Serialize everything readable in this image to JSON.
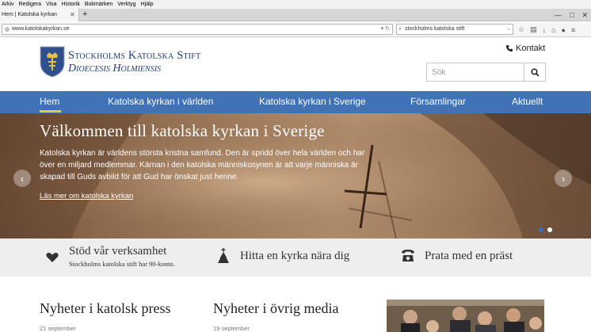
{
  "browser": {
    "menu": [
      "Arkiv",
      "Redigera",
      "Visa",
      "Historik",
      "Bokmärken",
      "Verktyg",
      "Hjälp"
    ],
    "tab_title": "Hem | Katolska kyrkan",
    "url": "www.katolskakyrkan.se",
    "search_value": "stockholms katolska stift",
    "icons": [
      "star-icon",
      "reading-list-icon",
      "download-icon",
      "home-icon",
      "chat-icon",
      "menu-icon"
    ]
  },
  "header": {
    "site_name": "Stockholms Katolska Stift",
    "site_latin": "Dioecesis Holmiensis",
    "contact_label": "Kontakt",
    "search_placeholder": "Sök"
  },
  "nav": {
    "items": [
      {
        "label": "Hem",
        "active": true
      },
      {
        "label": "Katolska kyrkan i världen"
      },
      {
        "label": "Katolska kyrkan i Sverige"
      },
      {
        "label": "Församlingar"
      },
      {
        "label": "Aktuellt"
      }
    ],
    "accent": "#f0c63a",
    "color": "#3f72b7"
  },
  "hero": {
    "title": "Välkommen till katolska kyrkan i Sverige",
    "text": "Katolska kyrkan är världens största kristna samfund. Den är spridd över hela världen och har över en miljard medlemmar. Kärnan i den katolska människosynen är att varje människa är skapad till Guds avbild för att Gud har önskat just henne.",
    "link": "Läs mer om katolska kyrkan",
    "slides_total": 2,
    "active_slide": 1
  },
  "features": [
    {
      "title": "Stöd vår verksamhet",
      "sub": "Stockholms katolska stift har 90-konto.",
      "icon": "heart-icon"
    },
    {
      "title": "Hitta en kyrka nära dig",
      "icon": "church-icon"
    },
    {
      "title": "Prata med en präst",
      "icon": "phone-icon"
    }
  ],
  "news": [
    {
      "heading": "Nyheter i katolsk press",
      "date": "21 september"
    },
    {
      "heading": "Nyheter i övrig media",
      "date": "19 september"
    }
  ]
}
